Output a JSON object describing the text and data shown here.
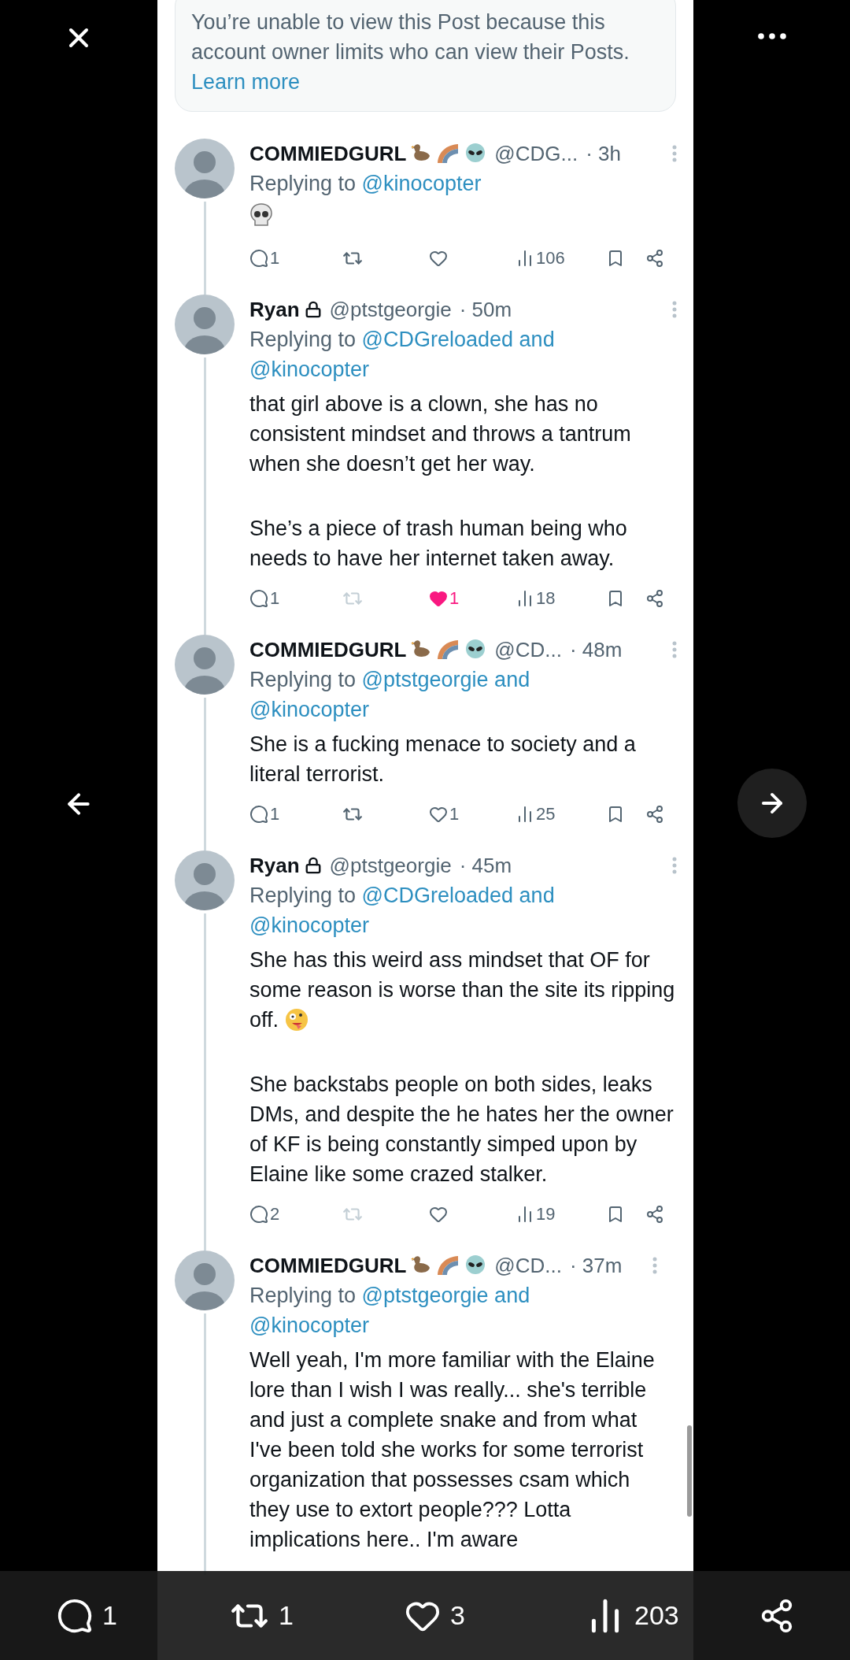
{
  "notice": {
    "text": "You’re unable to view this Post because this account owner limits who can view their Posts.",
    "link": "Learn more"
  },
  "tweets": [
    {
      "name": "COMMIEDGURL",
      "badges": true,
      "locked": false,
      "handle": "@CDG...",
      "time": "· 3h",
      "replying": "Replying to",
      "mentions": [
        "@kinocopter"
      ],
      "body": [
        {
          "kind": "skull"
        }
      ],
      "actions": {
        "reply": "1",
        "liked": false,
        "retweet_muted": false,
        "views": "106"
      }
    },
    {
      "name": "Ryan",
      "badges": false,
      "locked": true,
      "handle": "@ptstgeorgie",
      "time": "· 50m",
      "replying": "Replying to",
      "mentions": [
        "@CDGreloaded and",
        "@kinocopter"
      ],
      "body": [
        {
          "kind": "text",
          "text": "that girl above is a clown, she has no consistent mindset and throws a tantrum when she doesn’t get her way."
        },
        {
          "kind": "text",
          "text": "She’s a piece of trash human being who needs to have her internet taken away."
        }
      ],
      "actions": {
        "reply": "1",
        "like": "1",
        "liked": true,
        "retweet_muted": true,
        "views": "18"
      }
    },
    {
      "name": "COMMIEDGURL",
      "badges": true,
      "locked": false,
      "handle": "@CD...",
      "time": "· 48m",
      "replying": "Replying to",
      "mentions": [
        "@ptstgeorgie and",
        "@kinocopter"
      ],
      "body": [
        {
          "kind": "text",
          "text": "She is a fucking menace to society and a literal terrorist."
        }
      ],
      "actions": {
        "reply": "1",
        "like": "1",
        "liked": false,
        "retweet_muted": false,
        "views": "25"
      }
    },
    {
      "name": "Ryan",
      "badges": false,
      "locked": true,
      "handle": "@ptstgeorgie",
      "time": "· 45m",
      "replying": "Replying to",
      "mentions": [
        "@CDGreloaded and",
        "@kinocopter"
      ],
      "body": [
        {
          "kind": "text_zany_face",
          "text": "She has this weird ass mindset that OF for some reason is worse than the site its ripping off."
        },
        {
          "kind": "text",
          "text": "She backstabs people on both sides, leaks DMs, and despite the he hates her the owner of KF is being constantly simped upon by Elaine like some crazed stalker."
        }
      ],
      "actions": {
        "reply": "2",
        "liked": false,
        "retweet_muted": true,
        "views": "19"
      }
    },
    {
      "name": "COMMIEDGURL",
      "badges": true,
      "locked": false,
      "handle": "@CD...",
      "time": "· 37m",
      "replying": "Replying to",
      "mentions": [
        "@ptstgeorgie and",
        "@kinocopter"
      ],
      "body": [
        {
          "kind": "text",
          "text": "Well yeah, I'm more familiar with the Elaine lore than I wish I was really... she's terrible and just a complete snake and from what I've been told she works for some terrorist organization that possesses csam which they use to extort people??? Lotta implications here.. I'm aware"
        }
      ]
    }
  ],
  "bottom_bar": {
    "reply": "1",
    "retweet": "1",
    "like": "3",
    "views": "203"
  }
}
